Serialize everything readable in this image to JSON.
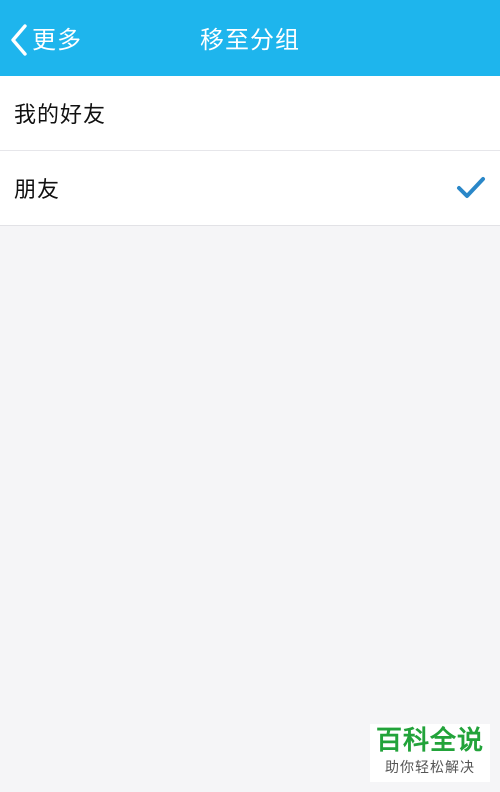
{
  "navbar": {
    "back_label": "更多",
    "title": "移至分组",
    "background_color": "#1eb5ed"
  },
  "groups": [
    {
      "label": "我的好友",
      "selected": false
    },
    {
      "label": "朋友",
      "selected": true
    }
  ],
  "check_icon": "checkmark-icon",
  "check_color": "#2a87c8",
  "watermark": {
    "title": "百科全说",
    "subtitle": "助你轻松解决"
  }
}
